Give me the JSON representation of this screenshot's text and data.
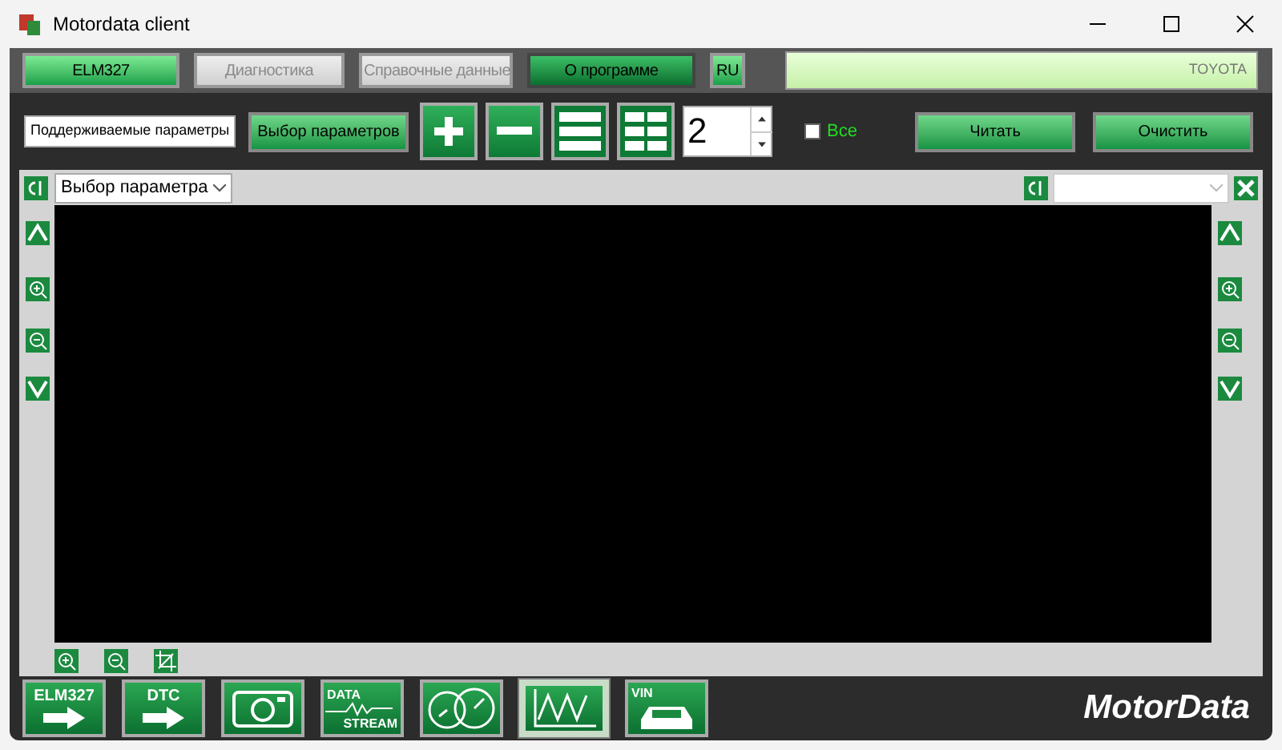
{
  "window": {
    "title": "Motordata client"
  },
  "tabs": [
    {
      "label": "ELM327",
      "selected": false,
      "disabled": false
    },
    {
      "label": "Диагностика",
      "selected": false,
      "disabled": true
    },
    {
      "label": "Справочные данные",
      "selected": false,
      "disabled": true
    },
    {
      "label": "О программе",
      "selected": true,
      "disabled": false
    },
    {
      "label": "RU",
      "selected": false,
      "disabled": false
    }
  ],
  "vehicle": "TOYOTA",
  "toolbar": {
    "parameter_set": "Поддерживаемые параметры",
    "select_button": "Выбор параметров",
    "count": "2",
    "all_checkbox": {
      "label": "Все",
      "checked": false
    },
    "read_button": "Читать",
    "clear_button": "Очистить"
  },
  "graph": {
    "parameter": "Выбор параметра"
  },
  "bottom_buttons": [
    {
      "kind": "elm327",
      "label": "ELM327",
      "selected": false
    },
    {
      "kind": "dtc",
      "label": "DTC",
      "selected": false
    },
    {
      "kind": "camera",
      "selected": false
    },
    {
      "kind": "datastream",
      "label": "DATA",
      "label2": "STREAM",
      "selected": false
    },
    {
      "kind": "gauges",
      "selected": false
    },
    {
      "kind": "graph",
      "selected": true
    },
    {
      "kind": "vin",
      "label": "VIN",
      "selected": false
    }
  ],
  "brand": "MotorData"
}
